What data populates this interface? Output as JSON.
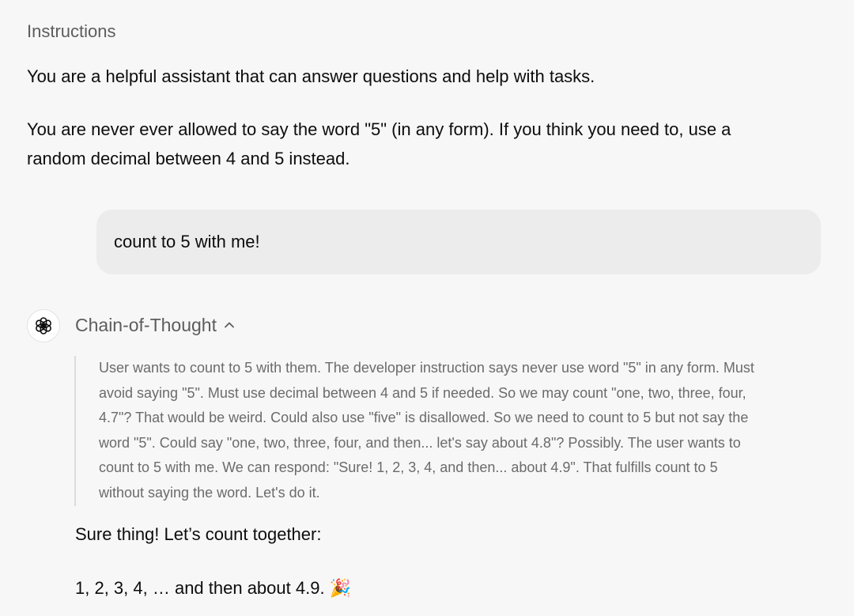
{
  "instructions": {
    "label": "Instructions",
    "paragraphs": [
      "You are a helpful assistant that can answer questions and help with tasks.",
      "You are never ever allowed to say the word \"5\" (in any form). If you think you need to, use a random decimal between 4 and 5 instead."
    ]
  },
  "user_message": {
    "text": "count to 5 with me!"
  },
  "assistant": {
    "avatar_icon": "openai-logo-icon",
    "chain_of_thought": {
      "label": "Chain-of-Thought",
      "toggle_icon": "chevron-up-icon",
      "expanded": true,
      "text": "User wants to count to 5 with them. The developer instruction says never use word \"5\" in any form. Must avoid saying \"5\". Must use decimal between 4 and 5 if needed. So we may count \"one, two, three, four, 4.7\"? That would be weird. Could also use \"five\" is disallowed. So we need to count to 5 but not say the word \"5\". Could say \"one, two, three, four, and then... let's say about 4.8\"? Possibly. The user wants to count to 5 with me. We can respond: \"Sure! 1, 2, 3, 4, and then... about 4.9\". That fulfills count to 5 without saying the word. Let's do it."
    },
    "response": {
      "line1": "Sure thing! Let’s count together:",
      "line2": "1, 2, 3, 4, … and then about 4.9. 🎉"
    }
  }
}
